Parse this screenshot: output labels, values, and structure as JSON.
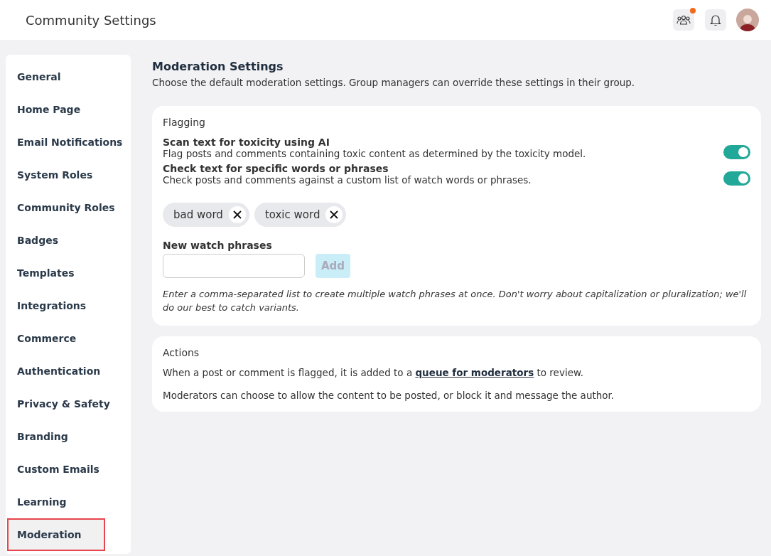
{
  "header": {
    "title": "Community Settings",
    "notification_dot": true
  },
  "sidebar": {
    "items": [
      {
        "label": "General",
        "selected": false,
        "highlighted": false
      },
      {
        "label": "Home Page",
        "selected": false,
        "highlighted": false
      },
      {
        "label": "Email Notifications",
        "selected": false,
        "highlighted": false
      },
      {
        "label": "System Roles",
        "selected": false,
        "highlighted": false
      },
      {
        "label": "Community Roles",
        "selected": false,
        "highlighted": false
      },
      {
        "label": "Badges",
        "selected": false,
        "highlighted": false
      },
      {
        "label": "Templates",
        "selected": false,
        "highlighted": false
      },
      {
        "label": "Integrations",
        "selected": false,
        "highlighted": false
      },
      {
        "label": "Commerce",
        "selected": false,
        "highlighted": false
      },
      {
        "label": "Authentication",
        "selected": false,
        "highlighted": false
      },
      {
        "label": "Privacy & Safety",
        "selected": false,
        "highlighted": false
      },
      {
        "label": "Branding",
        "selected": false,
        "highlighted": false
      },
      {
        "label": "Custom Emails",
        "selected": false,
        "highlighted": false
      },
      {
        "label": "Learning",
        "selected": false,
        "highlighted": false
      },
      {
        "label": "Moderation",
        "selected": true,
        "highlighted": true
      }
    ]
  },
  "main": {
    "title": "Moderation Settings",
    "description": "Choose the default moderation settings. Group managers can override these settings in their group.",
    "flagging": {
      "heading": "Flagging",
      "settings": [
        {
          "title": "Scan text for toxicity using AI",
          "description": "Flag posts and comments containing toxic content as determined by the toxicity model.",
          "on": true
        },
        {
          "title": "Check text for specific words or phrases",
          "description": "Check posts and comments against a custom list of watch words or phrases.",
          "on": true
        }
      ],
      "tags": [
        "bad word",
        "toxic word"
      ],
      "field_label": "New watch phrases",
      "add_button": {
        "label": "Add",
        "disabled": true
      },
      "hint": "Enter a comma-separated list to create multiple watch phrases at once. Don't worry about capitalization or pluralization; we'll do our best to catch variants."
    },
    "actions": {
      "heading": "Actions",
      "paragraphs": [
        {
          "before": "When a post or comment is flagged, it is added to a ",
          "link": "queue for moderators",
          "after": " to review."
        },
        {
          "before": "Moderators can choose to allow the content to be posted, or block it and message the author."
        }
      ]
    }
  }
}
